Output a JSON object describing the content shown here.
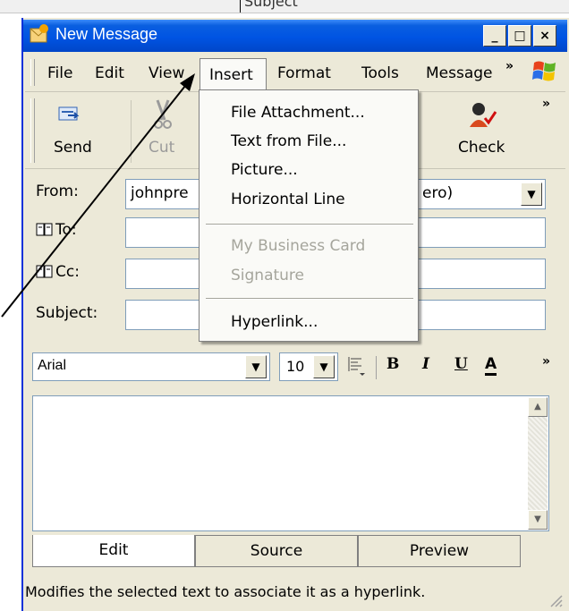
{
  "background": {
    "subject_label": "Subject"
  },
  "window": {
    "title": "New Message",
    "caption_buttons": {
      "minimize": "_",
      "maximize": "□",
      "close": "×"
    }
  },
  "menubar": {
    "items": [
      "File",
      "Edit",
      "View",
      "Insert",
      "Format",
      "Tools",
      "Message"
    ],
    "overflow": "»"
  },
  "toolbar": {
    "send_label": "Send",
    "cut_label": "Cut",
    "check_label": "Check",
    "overflow": "»"
  },
  "fields": {
    "from_label": "From:",
    "from_value": "johnpre",
    "from_value_tail": "ero)",
    "to_label": "To:",
    "cc_label": "Cc:",
    "subject_label": "Subject:"
  },
  "insert_menu": {
    "items": [
      {
        "label": "File Attachment...",
        "enabled": true
      },
      {
        "label": "Text from File...",
        "enabled": true
      },
      {
        "label": "Picture...",
        "enabled": true
      },
      {
        "label": "Horizontal Line",
        "enabled": true
      },
      {
        "label": "My Business Card",
        "enabled": false
      },
      {
        "label": "Signature",
        "enabled": false
      },
      {
        "label": "Hyperlink...",
        "enabled": true
      }
    ]
  },
  "format_bar": {
    "font": "Arial",
    "size": "10",
    "bold": "B",
    "italic": "I",
    "underline": "U",
    "font_color": "A",
    "overflow": "»"
  },
  "tabs": [
    "Edit",
    "Source",
    "Preview"
  ],
  "active_tab": "Edit",
  "status_text": "Modifies the selected text to associate it as a hyperlink.",
  "colors": {
    "titlebar": "#0054e3",
    "window_face": "#ece9d8",
    "disabled_text": "#a5a59c",
    "field_border": "#7f9db9"
  }
}
